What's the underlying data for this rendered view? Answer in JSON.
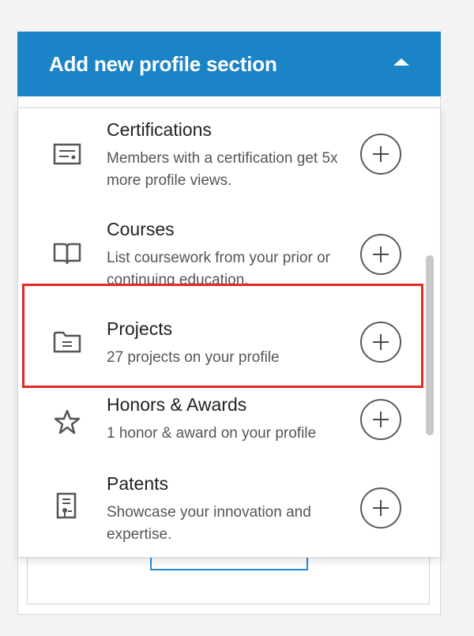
{
  "header": {
    "title": "Add new profile section",
    "caret_icon": "caret-up-icon"
  },
  "sections": [
    {
      "title": "Certifications",
      "description": "Members with a certification get 5x more profile views.",
      "icon": "certificate-icon"
    },
    {
      "title": "Courses",
      "description": "List coursework from your prior or continuing education.",
      "icon": "book-icon"
    },
    {
      "title": "Projects",
      "description": "27 projects on your profile",
      "icon": "folder-icon"
    },
    {
      "title": "Honors & Awards",
      "description": "1 honor & award on your profile",
      "icon": "star-icon"
    },
    {
      "title": "Patents",
      "description": "Showcase your innovation and expertise.",
      "icon": "patent-icon"
    }
  ],
  "colors": {
    "header_bg": "#1a84c6",
    "highlight": "#e22a22"
  }
}
